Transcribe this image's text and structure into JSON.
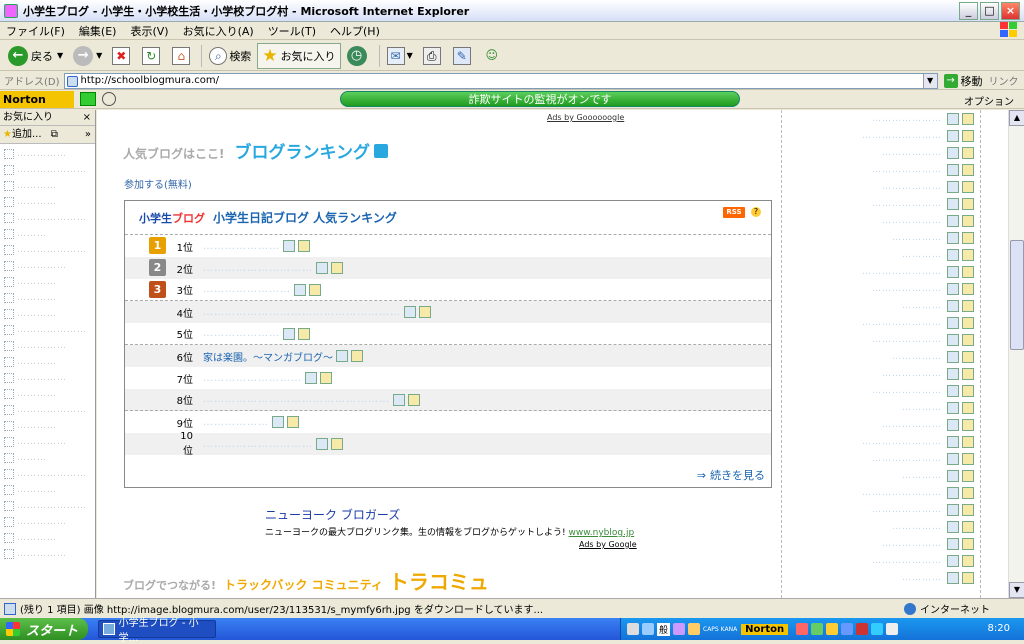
{
  "window": {
    "title": "小学生ブログ - 小学生・小学校生活・小学校ブログ村 - Microsoft Internet Explorer",
    "min_glyph": "_",
    "max_glyph": "□",
    "close_glyph": "×"
  },
  "menu": [
    "ファイル(F)",
    "編集(E)",
    "表示(V)",
    "お気に入り(A)",
    "ツール(T)",
    "ヘルプ(H)"
  ],
  "toolbar": {
    "back_label": "戻る",
    "search_label": "検索",
    "favorites_label": "お気に入り"
  },
  "address": {
    "label": "アドレス(D)",
    "url": "http://schoolblogmura.com/",
    "go_label": "移動",
    "links_label": "リンク"
  },
  "norton": {
    "logo": "Norton",
    "status": "詐欺サイトの監視がオンです",
    "options_label": "オプション"
  },
  "favorites_pane": {
    "title": "お気に入り",
    "add_label": "追加...",
    "close_glyph": "×",
    "more_glyph": "»",
    "items": [
      "……………",
      "…………………",
      "…………",
      "…………",
      "…………………",
      "………",
      "…………………",
      "……………",
      "…………",
      "…………",
      "…………",
      "…………………",
      "……………",
      "…………",
      "……………",
      "…………",
      "…………………",
      "…………",
      "……………",
      "………",
      "…………………",
      "…………",
      "…………………",
      "……………",
      "…………",
      "……………"
    ]
  },
  "page": {
    "ads_top": "Ads by Goooooogle",
    "ranking_pre": "人気ブログはここ!",
    "ranking_title": "ブログランキング",
    "join_link": "参加する(無料)",
    "box": {
      "logo_main": "小学生",
      "logo_sub": "ブログ",
      "title": "小学生日記ブログ 人気ランキング",
      "rss": "RSS",
      "help": "?",
      "more_link": "続きを見る",
      "more_arrow": "⇒",
      "rows": [
        {
          "rank": "1",
          "pos": "1位",
          "name": "…………………",
          "visible": false
        },
        {
          "rank": "2",
          "pos": "2位",
          "name": "…………………………",
          "visible": false
        },
        {
          "rank": "3",
          "pos": "3位",
          "name": "……………………",
          "visible": false
        },
        {
          "rank": "",
          "pos": "4位",
          "name": "………………………………………………",
          "visible": false
        },
        {
          "rank": "",
          "pos": "5位",
          "name": "…………………",
          "visible": false
        },
        {
          "rank": "",
          "pos": "6位",
          "name": "家は楽園。～マンガブログ～",
          "visible": true
        },
        {
          "rank": "",
          "pos": "7位",
          "name": "………………………",
          "visible": false
        },
        {
          "rank": "",
          "pos": "8位",
          "name": "……………………………………………",
          "visible": false
        },
        {
          "rank": "",
          "pos": "9位",
          "name": "………………",
          "visible": false
        },
        {
          "rank": "",
          "pos": "10位",
          "name": "…………………………",
          "visible": false
        }
      ]
    },
    "ny_ad": {
      "title": "ニューヨーク ブロガーズ",
      "desc": "ニューヨークの最大ブログリンク集。生の情報をブログからゲットしよう!",
      "url": "www.nyblog.jp"
    },
    "ads_bottom": "Ads by Google",
    "tracomi": {
      "pre": "ブログでつながる!",
      "mid": "トラックバック コミュニティ",
      "big": "トラコミュ"
    },
    "right_col_rows": [
      "…………………",
      "……………………",
      "………………",
      "…………………",
      "………………",
      "…………………",
      "………………",
      "……………",
      "…………",
      "……………………",
      "…………………",
      "…………",
      "……………………",
      "…………………",
      "……………",
      "………………",
      "…………………",
      "…………",
      "………………",
      "……………………",
      "…………………",
      "…………",
      "……………………",
      "…………………",
      "……………",
      "………………",
      "…………………",
      "…………"
    ]
  },
  "status": {
    "text": "(残り 1 項目) 画像 http://image.blogmura.com/user/23/113531/s_mymfy6rh.jpg をダウンロードしています...",
    "zone": "インターネット"
  },
  "taskbar": {
    "start": "スタート",
    "task": "小学生ブログ - 小学...",
    "ime": "般",
    "caps": "CAPS\nKANA",
    "norton": "Norton",
    "clock": "8:20"
  },
  "colors": {
    "accent_blue": "#29a8e0",
    "link_blue": "#1a64b0",
    "norton_yellow": "#f5c400",
    "tracomi_orange": "#f0a800"
  }
}
